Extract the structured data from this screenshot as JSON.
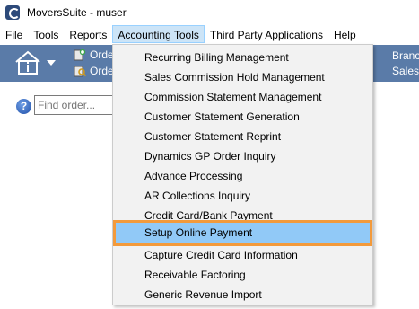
{
  "window": {
    "title": "MoversSuite - muser"
  },
  "menubar": {
    "items": [
      "File",
      "Tools",
      "Reports",
      "Accounting Tools",
      "Third Party Applications",
      "Help"
    ]
  },
  "toolbar": {
    "row1": "Orde",
    "row2": "Orde",
    "right1": "Branc",
    "right2": "Sales"
  },
  "search": {
    "placeholder": "Find order..."
  },
  "accounting_menu": {
    "items": [
      "Recurring Billing Management",
      "Sales Commission Hold Management",
      "Commission Statement Management",
      "Customer Statement Generation",
      "Customer Statement Reprint",
      "Dynamics GP Order Inquiry",
      "Advance Processing",
      "AR Collections Inquiry",
      "Credit Card/Bank Payment",
      "Setup Online Payment",
      "Capture Credit Card Information",
      "Receivable Factoring",
      "Generic Revenue Import"
    ],
    "highlighted": "Setup Online Payment"
  },
  "colors": {
    "toolbar": "#5a7ba8",
    "menu_open_bg": "#cce4f7",
    "highlight_bg": "#91c9f7",
    "highlight_outline": "#f39a3b"
  }
}
